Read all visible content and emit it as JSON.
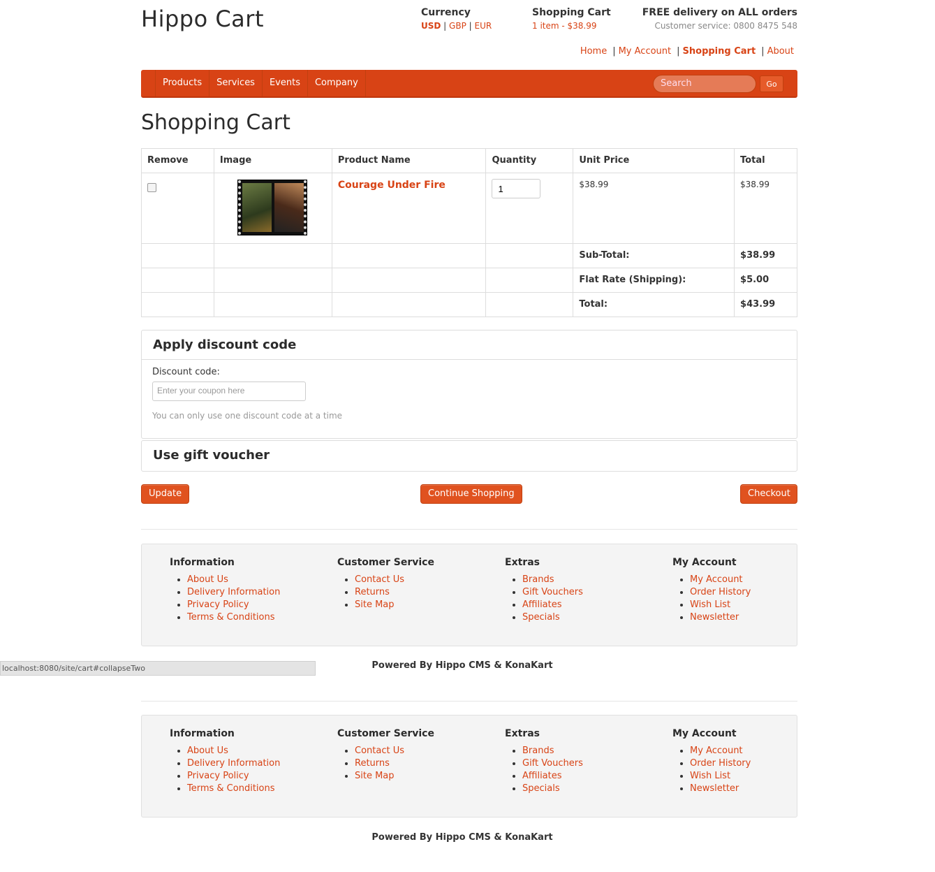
{
  "header": {
    "logo": "Hippo Cart",
    "currency": {
      "title": "Currency",
      "options": [
        "USD",
        "GBP",
        "EUR"
      ],
      "selected": "USD"
    },
    "cart": {
      "title": "Shopping Cart",
      "summary": "1 item - $38.99"
    },
    "delivery": {
      "title": "FREE delivery on ALL orders",
      "service": "Customer service: 0800 8475 548"
    },
    "links": [
      "Home",
      "My Account",
      "Shopping Cart",
      "About"
    ]
  },
  "nav": {
    "items": [
      "Products",
      "Services",
      "Events",
      "Company"
    ],
    "search_placeholder": "Search",
    "go_label": "Go"
  },
  "page_title": "Shopping Cart",
  "cart_table": {
    "headers": [
      "Remove",
      "Image",
      "Product Name",
      "Quantity",
      "Unit Price",
      "Total"
    ],
    "items": [
      {
        "name": "Courage Under Fire",
        "quantity": "1",
        "unit_price": "$38.99",
        "total": "$38.99"
      }
    ],
    "summary": [
      {
        "label": "Sub-Total:",
        "amount": "$38.99"
      },
      {
        "label": "Flat Rate (Shipping):",
        "amount": "$5.00"
      },
      {
        "label": "Total:",
        "amount": "$43.99"
      }
    ]
  },
  "discount": {
    "title": "Apply discount code",
    "label": "Discount code:",
    "placeholder": "Enter your coupon here",
    "help": "You can only use one discount code at a time"
  },
  "voucher": {
    "title": "Use gift voucher"
  },
  "buttons": {
    "update": "Update",
    "continue": "Continue Shopping",
    "checkout": "Checkout"
  },
  "footer": {
    "columns": [
      {
        "title": "Information",
        "links": [
          "About Us",
          "Delivery Information",
          "Privacy Policy",
          "Terms & Conditions"
        ]
      },
      {
        "title": "Customer Service",
        "links": [
          "Contact Us",
          "Returns",
          "Site Map"
        ]
      },
      {
        "title": "Extras",
        "links": [
          "Brands",
          "Gift Vouchers",
          "Affiliates",
          "Specials"
        ]
      },
      {
        "title": "My Account",
        "links": [
          "My Account",
          "Order History",
          "Wish List",
          "Newsletter"
        ]
      }
    ],
    "powered": "Powered By Hippo CMS & KonaKart"
  },
  "status_bar": "localhost:8080/site/cart#collapseTwo",
  "colors": {
    "accent": "#d84315",
    "nav_bg": "#d84315"
  }
}
